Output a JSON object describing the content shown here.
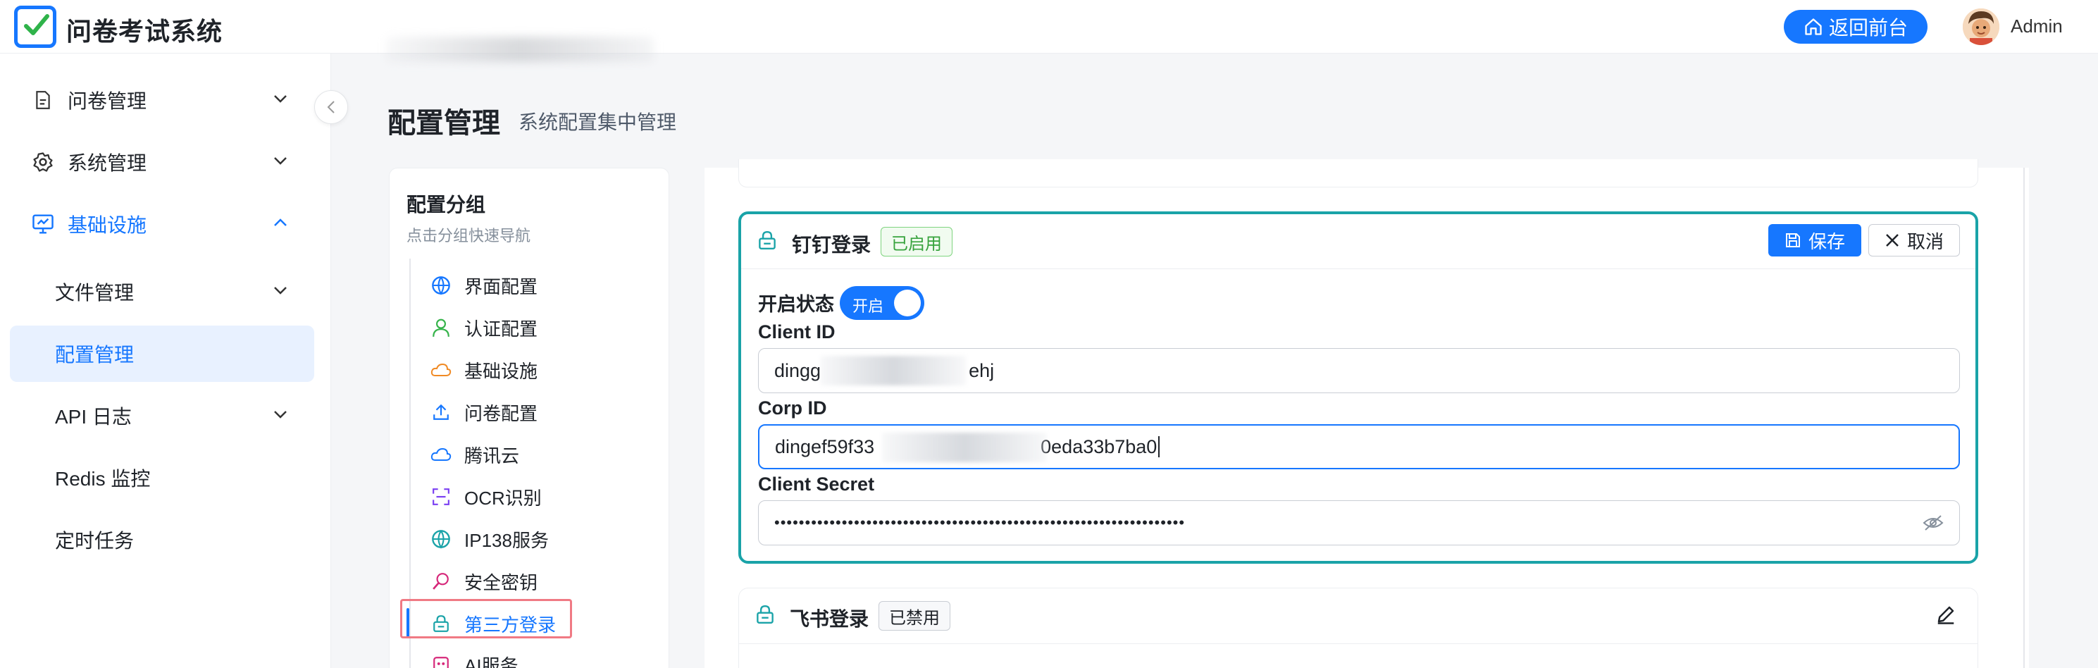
{
  "app": {
    "title": "问卷考试系统"
  },
  "header": {
    "back_label": "返回前台",
    "user_name": "Admin"
  },
  "sidebar": {
    "items": [
      {
        "label": "问卷管理",
        "icon": "document-icon"
      },
      {
        "label": "系统管理",
        "icon": "gear-icon"
      },
      {
        "label": "基础设施",
        "icon": "monitor-icon"
      },
      {
        "label": "文件管理"
      },
      {
        "label": "配置管理"
      },
      {
        "label": "API 日志"
      },
      {
        "label": "Redis 监控"
      },
      {
        "label": "定时任务"
      }
    ]
  },
  "page": {
    "title": "配置管理",
    "subtitle": "系统配置集中管理"
  },
  "groups": {
    "title": "配置分组",
    "hint": "点击分组快速导航",
    "items": [
      {
        "label": "界面配置",
        "icon": "globe-icon"
      },
      {
        "label": "认证配置",
        "icon": "user-icon"
      },
      {
        "label": "基础设施",
        "icon": "cloud-icon"
      },
      {
        "label": "问卷配置",
        "icon": "upload-icon"
      },
      {
        "label": "腾讯云",
        "icon": "cloud-icon"
      },
      {
        "label": "OCR识别",
        "icon": "scan-icon"
      },
      {
        "label": "IP138服务",
        "icon": "globe-icon"
      },
      {
        "label": "安全密钥",
        "icon": "search-icon"
      },
      {
        "label": "第三方登录",
        "icon": "lock-icon"
      },
      {
        "label": "AI服务",
        "icon": "robot-icon"
      }
    ]
  },
  "ding": {
    "title": "钉钉登录",
    "status_tag": "已启用",
    "save_label": "保存",
    "cancel_label": "取消",
    "enable_label": "开启状态",
    "toggle_label": "开启",
    "client_id_label": "Client ID",
    "client_id_start": "dingg",
    "client_id_end": "ehj",
    "corp_id_label": "Corp ID",
    "corp_id_start": "dingef59f33",
    "corp_id_end": "0eda33b7ba0",
    "client_secret_label": "Client Secret",
    "client_secret_value": "•••••••••••••••••••••••••••••••••••••••••••••••••••••••••••••••••••"
  },
  "feishu": {
    "title": "飞书登录",
    "status_tag": "已禁用"
  },
  "colors": {
    "primary": "#1677ff",
    "teal": "#1aa3a8",
    "success": "#37a33d"
  }
}
